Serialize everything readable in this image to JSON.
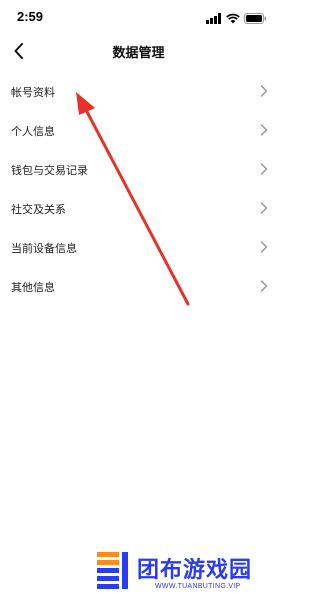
{
  "status_bar": {
    "time": "2:59",
    "icons": [
      "signal-icon",
      "wifi-icon",
      "battery-icon"
    ]
  },
  "nav": {
    "title": "数据管理",
    "back_icon": "chevron-left-icon"
  },
  "menu": {
    "items": [
      {
        "label": "帐号资料"
      },
      {
        "label": "个人信息"
      },
      {
        "label": "钱包与交易记录"
      },
      {
        "label": "社交及关系"
      },
      {
        "label": "当前设备信息"
      },
      {
        "label": "其他信息"
      }
    ]
  },
  "annotation": {
    "color": "#e8312a"
  },
  "watermark": {
    "title": "团布游戏园",
    "subtitle": "WWW.TUANBUTING.VIP",
    "color": "#2a3cf0",
    "accent": "#ff8a1f"
  }
}
